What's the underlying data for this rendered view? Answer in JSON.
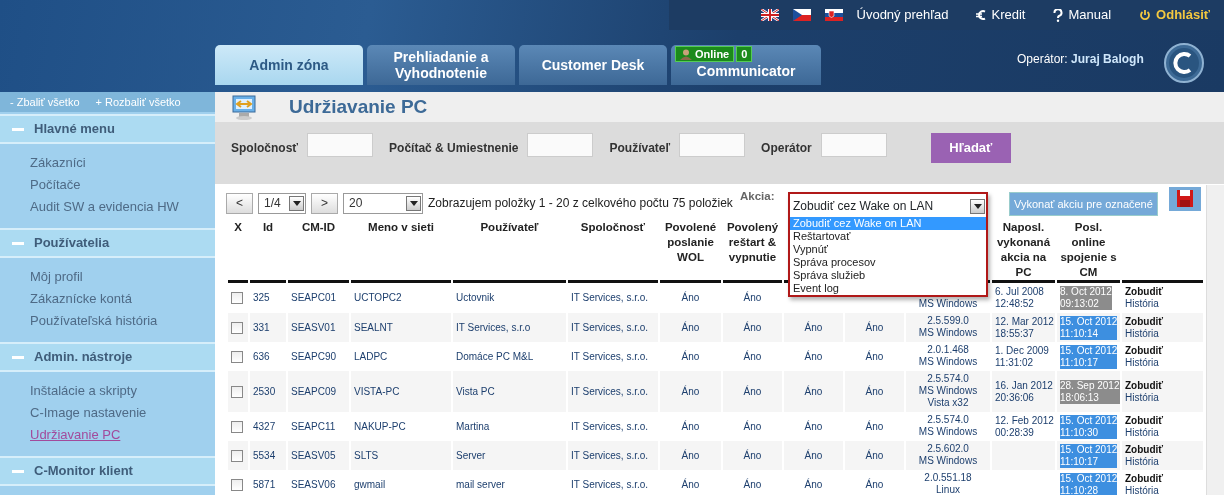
{
  "top_links": [
    {
      "kind": "plain",
      "label": "Úvodný prehľad"
    },
    {
      "kind": "euro",
      "label": "Kredit"
    },
    {
      "kind": "help",
      "label": "Manual"
    },
    {
      "kind": "power",
      "label": "Odhlásiť"
    }
  ],
  "tabs": [
    {
      "label": "Admin zóna",
      "selected": true
    },
    {
      "label": "Prehliadanie a Vyhodnotenie",
      "selected": false
    },
    {
      "label": "Customer Desk",
      "selected": false
    },
    {
      "label": "Communicator",
      "selected": false,
      "badge": "Online",
      "count": "0"
    }
  ],
  "operator": {
    "label": "Operátor:",
    "name": "Juraj Balogh"
  },
  "sidebar": {
    "collapse_all": "- Zbaliť všetko",
    "expand_all": "+ Rozbaliť všetko",
    "sections": [
      {
        "title": "Hlavné menu",
        "expanded": true,
        "items": [
          {
            "label": "Zákazníci",
            "selected": false
          },
          {
            "label": "Počítače",
            "selected": false
          },
          {
            "label": "Audit SW a evidencia HW",
            "selected": false
          }
        ]
      },
      {
        "title": "Používatelia",
        "expanded": true,
        "items": [
          {
            "label": "Môj profil",
            "selected": false
          },
          {
            "label": "Zákaznícke kontá",
            "selected": false
          },
          {
            "label": "Používateľská história",
            "selected": false
          }
        ]
      },
      {
        "title": "Admin. nástroje",
        "expanded": true,
        "items": [
          {
            "label": "Inštalácie a skripty",
            "selected": false
          },
          {
            "label": "C-Image nastavenie",
            "selected": false
          },
          {
            "label": "Udržiavanie PC",
            "selected": true
          }
        ]
      },
      {
        "title": "C-Monitor klient",
        "expanded": true
      }
    ]
  },
  "page_title": "Udržiavanie PC",
  "filters": [
    {
      "label": "Spoločnosť"
    },
    {
      "label": "Počítač & Umiestnenie"
    },
    {
      "label": "Používateľ"
    },
    {
      "label": "Operátor"
    }
  ],
  "search_button": "Hľadať",
  "pager": {
    "prev": "<",
    "page": "1/4",
    "next": ">",
    "page_size": "20",
    "summary": "Zobrazujem položky 1 - 20 z celkového počtu 75 položiek"
  },
  "action": {
    "label": "Akcia:",
    "value": "Zobudiť cez Wake on LAN",
    "expanded": true,
    "options": [
      {
        "label": "Zobudiť cez Wake on LAN",
        "selected": true
      },
      {
        "label": "Reštartovať",
        "selected": false
      },
      {
        "label": "Vypnúť",
        "selected": false
      },
      {
        "label": "Správa procesov",
        "selected": false
      },
      {
        "label": "Správa služieb",
        "selected": false
      },
      {
        "label": "Event log",
        "selected": false
      }
    ],
    "execute_button": "Vykonať akciu pre označené"
  },
  "table": {
    "select_header": "X",
    "columns": [
      "Id",
      "CM-ID",
      "Meno v sieti",
      "Používateľ",
      "Spoločnosť",
      "Povolené poslanie WOL",
      "Povolený reštart & vypnutie",
      "",
      "",
      "",
      "Naposl. vykonaná akcia na PC",
      "Posl. online spojenie s CM"
    ],
    "rows": [
      {
        "checked": false,
        "cells": [
          "325",
          "SEAPC01",
          "UCTOPC2",
          "Uctovnik",
          "IT Services, s.r.o.",
          "Áno",
          "Áno",
          null,
          null,
          [
            "MS Windows"
          ],
          [
            "6. Jul 2008",
            "12:48:52"
          ],
          [
            "8. Oct 2012",
            "09:13:02"
          ]
        ],
        "color": "#8c8c8c",
        "actions": [
          "Zobudiť",
          "História"
        ]
      },
      {
        "checked": false,
        "cells": [
          "331",
          "SEASV01",
          "SEALNT",
          "IT Services, s.r.o",
          "IT Services, s.r.o.",
          "Áno",
          "Áno",
          "Áno",
          "Áno",
          [
            "2.5.599.0",
            "MS Windows"
          ],
          [
            "12. Mar 2012",
            "18:55:37"
          ],
          [
            "15. Oct 2012",
            "11:10:14"
          ]
        ],
        "color": "#3d8fe0",
        "actions": [
          "Zobudiť",
          "História"
        ]
      },
      {
        "checked": false,
        "cells": [
          "636",
          "SEAPC90",
          "LADPC",
          "Domáce PC M&L",
          "IT Services, s.r.o.",
          "Áno",
          "Áno",
          "Áno",
          "Áno",
          [
            "2.0.1.468",
            "MS Windows"
          ],
          [
            "1. Dec 2009",
            "11:31:02"
          ],
          [
            "15. Oct 2012",
            "11:10:17"
          ]
        ],
        "color": "#3d8fe0",
        "actions": [
          "Zobudiť",
          "História"
        ]
      },
      {
        "checked": false,
        "cells": [
          "2530",
          "SEAPC09",
          "VISTA-PC",
          "Vista PC",
          "IT Services, s.r.o.",
          "Áno",
          "Áno",
          "Áno",
          "Áno",
          [
            "2.5.574.0",
            "MS Windows",
            "Vista x32"
          ],
          [
            "16. Jan 2012",
            "20:36:06"
          ],
          [
            "28. Sep 2012",
            "18:06:13"
          ]
        ],
        "color": "#8c8c8c",
        "actions": [
          "Zobudiť",
          "História"
        ]
      },
      {
        "checked": false,
        "cells": [
          "4327",
          "SEAPC11",
          "NAKUP-PC",
          "Martina",
          "IT Services, s.r.o.",
          "Áno",
          "Áno",
          "Áno",
          "Áno",
          [
            "2.5.574.0",
            "MS Windows"
          ],
          [
            "12. Feb 2012",
            "00:28:39"
          ],
          [
            "15. Oct 2012",
            "11:10:30"
          ]
        ],
        "color": "#3d8fe0",
        "actions": [
          "Zobudiť",
          "História"
        ]
      },
      {
        "checked": false,
        "cells": [
          "5534",
          "SEASV05",
          "SLTS",
          "Server",
          "IT Services, s.r.o.",
          "Áno",
          "Áno",
          "Áno",
          "Áno",
          [
            "2.5.602.0",
            "MS Windows"
          ],
          null,
          [
            "15. Oct 2012",
            "11:10:17"
          ]
        ],
        "color": "#3d8fe0",
        "actions": [
          "Zobudiť",
          "História"
        ]
      },
      {
        "checked": false,
        "cells": [
          "5871",
          "SEASV06",
          "gwmail",
          "mail server",
          "IT Services, s.r.o.",
          "Áno",
          "Áno",
          "Áno",
          "Áno",
          [
            "2.0.551.18",
            "Linux"
          ],
          null,
          [
            "15. Oct 2012",
            "11:10:28"
          ]
        ],
        "color": "#3d8fe0",
        "actions": [
          "Zobudiť",
          "História"
        ]
      }
    ]
  }
}
